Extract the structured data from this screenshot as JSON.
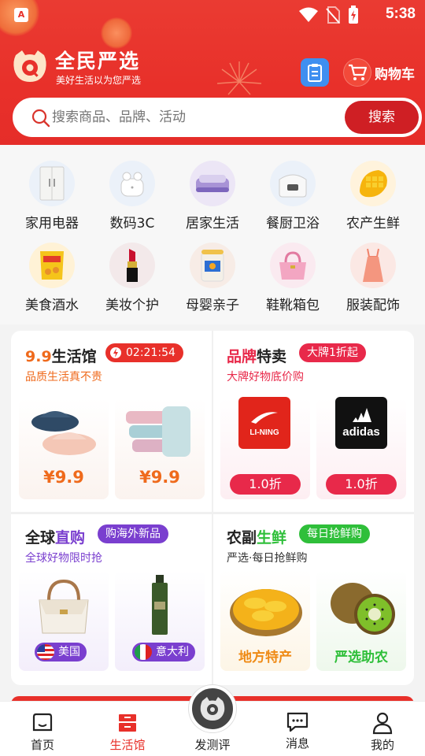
{
  "status_bar": {
    "time": "5:38",
    "left_icon": "A"
  },
  "header": {
    "title": "全民严选",
    "subtitle": "美好生活以为您严选",
    "cart_label": "购物车"
  },
  "search": {
    "placeholder": "搜索商品、品牌、活动",
    "button": "搜索"
  },
  "categories": [
    {
      "label": "家用电器",
      "icon": "fridge-icon"
    },
    {
      "label": "数码3C",
      "icon": "earbuds-icon"
    },
    {
      "label": "居家生活",
      "icon": "bedding-icon"
    },
    {
      "label": "餐厨卫浴",
      "icon": "rice-cooker-icon"
    },
    {
      "label": "农产生鲜",
      "icon": "mango-icon"
    },
    {
      "label": "美食酒水",
      "icon": "snack-icon"
    },
    {
      "label": "美妆个护",
      "icon": "lipstick-icon"
    },
    {
      "label": "母婴亲子",
      "icon": "formula-can-icon"
    },
    {
      "label": "鞋靴箱包",
      "icon": "handbag-icon"
    },
    {
      "label": "服装配饰",
      "icon": "dress-icon"
    }
  ],
  "sections": {
    "life": {
      "title_prefix": "9.9",
      "title_suffix": "生活馆",
      "timer": "02:21:54",
      "subtitle": "品质生活真不贵",
      "items": [
        {
          "price": "¥9.9",
          "icon": "slippers-icon"
        },
        {
          "price": "¥9.9",
          "icon": "towels-icon"
        }
      ]
    },
    "brand": {
      "title_a": "品牌",
      "title_b": "特卖",
      "badge": "大牌1折起",
      "subtitle": "大牌好物底价购",
      "items": [
        {
          "brand": "LI-NING",
          "discount": "1.0折"
        },
        {
          "brand": "adidas",
          "discount": "1.0折"
        }
      ]
    },
    "global": {
      "title_a": "全球",
      "title_b": "直购",
      "badge": "购海外新品",
      "subtitle": "全球好物限时抢",
      "items": [
        {
          "country": "美国",
          "icon": "handbag-icon"
        },
        {
          "country": "意大利",
          "icon": "serum-bottle-icon"
        }
      ]
    },
    "fresh": {
      "title_a": "农副",
      "title_b": "生鲜",
      "badge": "每日抢鲜购",
      "subtitle": "严选·每日抢鲜购",
      "items": [
        {
          "label": "地方特产",
          "icon": "mango-slices-icon"
        },
        {
          "label": "严选助农",
          "icon": "kiwi-icon"
        }
      ]
    }
  },
  "tabbar": [
    {
      "label": "首页",
      "icon": "home-icon"
    },
    {
      "label": "生活馆",
      "icon": "store-icon"
    },
    {
      "label": "发测评",
      "icon": "review-icon"
    },
    {
      "label": "消息",
      "icon": "message-icon"
    },
    {
      "label": "我的",
      "icon": "profile-icon"
    }
  ],
  "colors": {
    "brand_red": "#e8302a",
    "accent_orange": "#ef6a1c",
    "purple": "#7a3fcf",
    "green": "#2fbf3a",
    "pink": "#e8294a"
  }
}
